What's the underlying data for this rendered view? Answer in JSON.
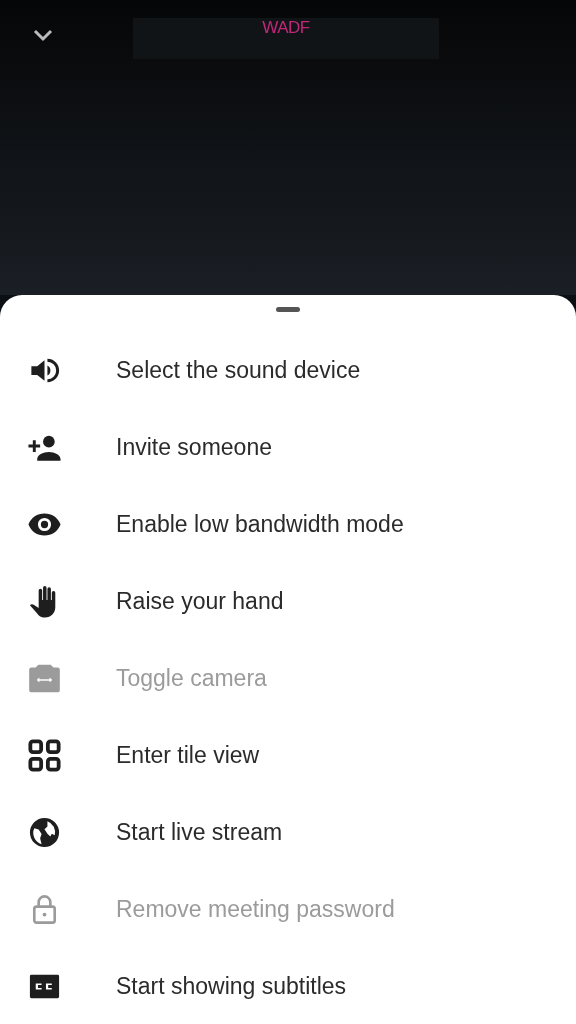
{
  "video": {
    "logo": "WADF"
  },
  "menu": [
    {
      "kind": "sound",
      "label": "Select the sound device",
      "disabled": false
    },
    {
      "kind": "invite",
      "label": "Invite someone",
      "disabled": false
    },
    {
      "kind": "eye",
      "label": "Enable low bandwidth mode",
      "disabled": false
    },
    {
      "kind": "hand",
      "label": "Raise your hand",
      "disabled": false
    },
    {
      "kind": "camera",
      "label": "Toggle camera",
      "disabled": true
    },
    {
      "kind": "tiles",
      "label": "Enter tile view",
      "disabled": false
    },
    {
      "kind": "globe",
      "label": "Start live stream",
      "disabled": false
    },
    {
      "kind": "lock",
      "label": "Remove meeting password",
      "disabled": true
    },
    {
      "kind": "captions",
      "label": "Start showing subtitles",
      "disabled": false
    }
  ]
}
